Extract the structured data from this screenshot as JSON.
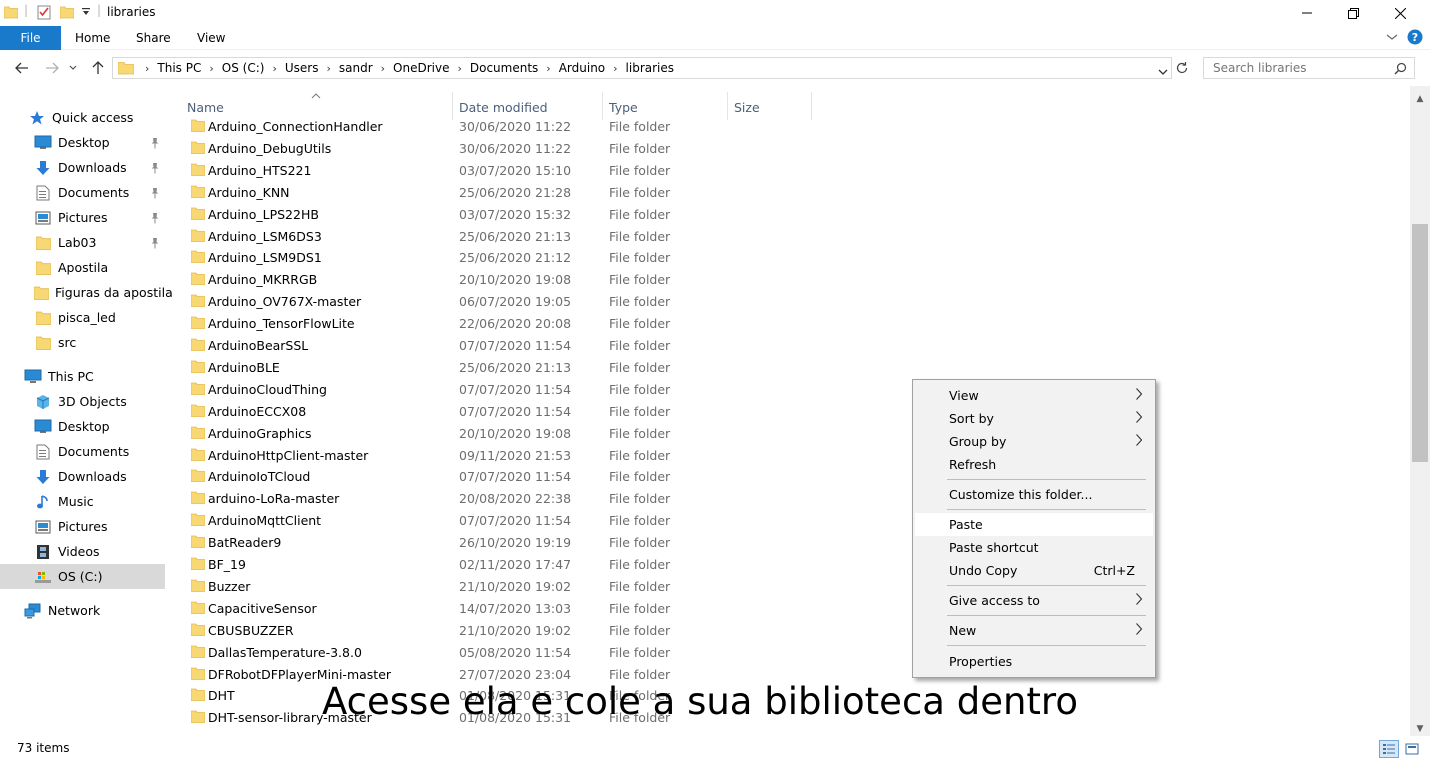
{
  "window": {
    "title": "libraries"
  },
  "ribbon": {
    "file": "File",
    "tabs": [
      "Home",
      "Share",
      "View"
    ]
  },
  "address": {
    "crumbs": [
      "This PC",
      "OS (C:)",
      "Users",
      "sandr",
      "OneDrive",
      "Documents",
      "Arduino",
      "libraries"
    ]
  },
  "search": {
    "placeholder": "Search libraries"
  },
  "sidebar": {
    "quick_access": "Quick access",
    "quick_items": [
      {
        "label": "Desktop",
        "icon": "desktop-icon",
        "pinned": true
      },
      {
        "label": "Downloads",
        "icon": "download-icon",
        "pinned": true
      },
      {
        "label": "Documents",
        "icon": "document-icon",
        "pinned": true
      },
      {
        "label": "Pictures",
        "icon": "pictures-icon",
        "pinned": true
      },
      {
        "label": "Lab03",
        "icon": "folder-icon",
        "pinned": true
      },
      {
        "label": "Apostila",
        "icon": "folder-icon",
        "pinned": false
      },
      {
        "label": "Figuras da apostila",
        "icon": "folder-icon",
        "pinned": false
      },
      {
        "label": "pisca_led",
        "icon": "folder-icon",
        "pinned": false
      },
      {
        "label": "src",
        "icon": "folder-icon",
        "pinned": false
      }
    ],
    "this_pc": "This PC",
    "pc_items": [
      {
        "label": "3D Objects",
        "icon": "cube-icon"
      },
      {
        "label": "Desktop",
        "icon": "desktop-icon"
      },
      {
        "label": "Documents",
        "icon": "document-icon"
      },
      {
        "label": "Downloads",
        "icon": "download-icon"
      },
      {
        "label": "Music",
        "icon": "music-icon"
      },
      {
        "label": "Pictures",
        "icon": "pictures-icon"
      },
      {
        "label": "Videos",
        "icon": "video-icon"
      },
      {
        "label": "OS (C:)",
        "icon": "drive-icon",
        "selected": true
      }
    ],
    "network": "Network"
  },
  "columns": {
    "name": "Name",
    "date": "Date modified",
    "type": "Type",
    "size": "Size"
  },
  "files": [
    {
      "name": "Arduino_ConnectionHandler",
      "date": "30/06/2020 11:22",
      "type": "File folder"
    },
    {
      "name": "Arduino_DebugUtils",
      "date": "30/06/2020 11:22",
      "type": "File folder"
    },
    {
      "name": "Arduino_HTS221",
      "date": "03/07/2020 15:10",
      "type": "File folder"
    },
    {
      "name": "Arduino_KNN",
      "date": "25/06/2020 21:28",
      "type": "File folder"
    },
    {
      "name": "Arduino_LPS22HB",
      "date": "03/07/2020 15:32",
      "type": "File folder"
    },
    {
      "name": "Arduino_LSM6DS3",
      "date": "25/06/2020 21:13",
      "type": "File folder"
    },
    {
      "name": "Arduino_LSM9DS1",
      "date": "25/06/2020 21:12",
      "type": "File folder"
    },
    {
      "name": "Arduino_MKRRGB",
      "date": "20/10/2020 19:08",
      "type": "File folder"
    },
    {
      "name": "Arduino_OV767X-master",
      "date": "06/07/2020 19:05",
      "type": "File folder"
    },
    {
      "name": "Arduino_TensorFlowLite",
      "date": "22/06/2020 20:08",
      "type": "File folder"
    },
    {
      "name": "ArduinoBearSSL",
      "date": "07/07/2020 11:54",
      "type": "File folder"
    },
    {
      "name": "ArduinoBLE",
      "date": "25/06/2020 21:13",
      "type": "File folder"
    },
    {
      "name": "ArduinoCloudThing",
      "date": "07/07/2020 11:54",
      "type": "File folder"
    },
    {
      "name": "ArduinoECCX08",
      "date": "07/07/2020 11:54",
      "type": "File folder"
    },
    {
      "name": "ArduinoGraphics",
      "date": "20/10/2020 19:08",
      "type": "File folder"
    },
    {
      "name": "ArduinoHttpClient-master",
      "date": "09/11/2020 21:53",
      "type": "File folder"
    },
    {
      "name": "ArduinoIoTCloud",
      "date": "07/07/2020 11:54",
      "type": "File folder"
    },
    {
      "name": "arduino-LoRa-master",
      "date": "20/08/2020 22:38",
      "type": "File folder"
    },
    {
      "name": "ArduinoMqttClient",
      "date": "07/07/2020 11:54",
      "type": "File folder"
    },
    {
      "name": "BatReader9",
      "date": "26/10/2020 19:19",
      "type": "File folder"
    },
    {
      "name": "BF_19",
      "date": "02/11/2020 17:47",
      "type": "File folder"
    },
    {
      "name": "Buzzer",
      "date": "21/10/2020 19:02",
      "type": "File folder"
    },
    {
      "name": "CapacitiveSensor",
      "date": "14/07/2020 13:03",
      "type": "File folder"
    },
    {
      "name": "CBUSBUZZER",
      "date": "21/10/2020 19:02",
      "type": "File folder"
    },
    {
      "name": "DallasTemperature-3.8.0",
      "date": "05/08/2020 11:54",
      "type": "File folder"
    },
    {
      "name": "DFRobotDFPlayerMini-master",
      "date": "27/07/2020 23:04",
      "type": "File folder"
    },
    {
      "name": "DHT",
      "date": "01/08/2020 15:31",
      "type": "File folder"
    },
    {
      "name": "DHT-sensor-library-master",
      "date": "01/08/2020 15:31",
      "type": "File folder"
    }
  ],
  "status": {
    "items": "73 items"
  },
  "context_menu": {
    "items": [
      {
        "label": "View",
        "submenu": true
      },
      {
        "label": "Sort by",
        "submenu": true
      },
      {
        "label": "Group by",
        "submenu": true
      },
      {
        "label": "Refresh"
      },
      {
        "label": "Customize this folder..."
      },
      {
        "label": "Paste",
        "hover": true
      },
      {
        "label": "Paste shortcut"
      },
      {
        "label": "Undo Copy",
        "shortcut": "Ctrl+Z"
      },
      {
        "label": "Give access to",
        "submenu": true
      },
      {
        "label": "New",
        "submenu": true
      },
      {
        "label": "Properties"
      }
    ]
  },
  "caption": "Acesse ela e cole a sua biblioteca dentro",
  "colors": {
    "accent": "#1979ca",
    "folder": "#f8d775",
    "folder_dark": "#e6b94a",
    "selected": "#d9d9d9"
  }
}
